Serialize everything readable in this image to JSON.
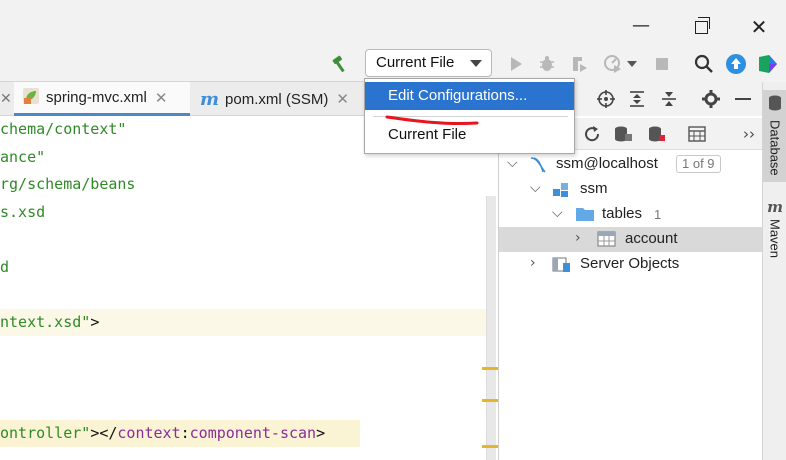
{
  "window": {
    "minimize_glyph": "—",
    "close_glyph": "✕"
  },
  "toolbar": {
    "build_icon": "hammer-icon",
    "run_config_label": "Current File",
    "run_icon": "run-icon",
    "debug_icon": "debug-icon",
    "coverage_icon": "coverage-icon",
    "profile_icon": "profile-icon",
    "stop_icon": "stop-icon",
    "search_icon": "search-icon",
    "update_icon": "update-icon",
    "plugin_icon": "plugin-icon"
  },
  "run_config_menu": {
    "items": [
      {
        "label": "Edit Configurations...",
        "selected": true
      },
      {
        "label": "Current File",
        "selected": false
      }
    ]
  },
  "tabs": [
    {
      "label": "spring-mvc.xml",
      "active": true,
      "icon": "spring-xml-icon",
      "close": "✕"
    },
    {
      "label": "pom.xml (SSM)",
      "active": false,
      "icon": "maven-icon",
      "close": "✕"
    }
  ],
  "editor": {
    "lines": [
      {
        "parts": [
          {
            "text": "chema/context\"",
            "kind": "str"
          }
        ]
      },
      {
        "parts": [
          {
            "text": "ance\"",
            "kind": "str"
          }
        ]
      },
      {
        "parts": [
          {
            "text": "rg/schema/beans",
            "kind": "str"
          }
        ]
      },
      {
        "parts": [
          {
            "text": "s.xsd",
            "kind": "str"
          }
        ]
      },
      {
        "parts": []
      },
      {
        "parts": [
          {
            "text": "d",
            "kind": "str"
          }
        ]
      },
      {
        "parts": []
      },
      {
        "parts": [
          {
            "text": "ntext.xsd\"",
            "kind": "str"
          },
          {
            "text": ">",
            "kind": "punct"
          }
        ]
      },
      {
        "parts": []
      },
      {
        "parts": []
      },
      {
        "parts": []
      },
      {
        "parts": [
          {
            "text": "ontroller\"",
            "kind": "str"
          },
          {
            "text": "></",
            "kind": "punct"
          },
          {
            "text": "context",
            "kind": "tag"
          },
          {
            "text": ":",
            "kind": "punct"
          },
          {
            "text": "component-scan",
            "kind": "tag"
          },
          {
            "text": ">",
            "kind": "punct"
          }
        ]
      }
    ]
  },
  "database_panel": {
    "toolbar_icons": [
      "crosshair-icon",
      "expand-all-icon",
      "collapse-all-icon",
      "settings-icon",
      "hide-icon"
    ],
    "toolbar2_icons": [
      "refresh-icon",
      "datasource-properties-icon",
      "stop-db-icon",
      "table-editor-icon"
    ],
    "more_glyph": "››",
    "tree": [
      {
        "label": "ssm@localhost",
        "badge": "1 of 9",
        "icon": "datasource-icon",
        "expanded": true,
        "selected": false
      },
      {
        "label": "ssm",
        "icon": "schema-icon",
        "expanded": true,
        "selected": false
      },
      {
        "label": "tables",
        "count": "1",
        "icon": "folder-icon",
        "expanded": true,
        "selected": false
      },
      {
        "label": "account",
        "icon": "table-icon",
        "expanded": false,
        "selected": true
      },
      {
        "label": "Server Objects",
        "icon": "server-objects-icon",
        "expanded": false,
        "selected": false
      }
    ]
  },
  "right_strip": {
    "tabs": [
      {
        "label": "Database",
        "icon": "database-icon",
        "active": true
      },
      {
        "label": "Maven",
        "icon": "maven-icon",
        "active": false
      }
    ]
  },
  "colors": {
    "accent": "#2a74cf",
    "string": "#2f8a26",
    "tag": "#8a2c9c",
    "annotation_red": "#e8141f"
  }
}
